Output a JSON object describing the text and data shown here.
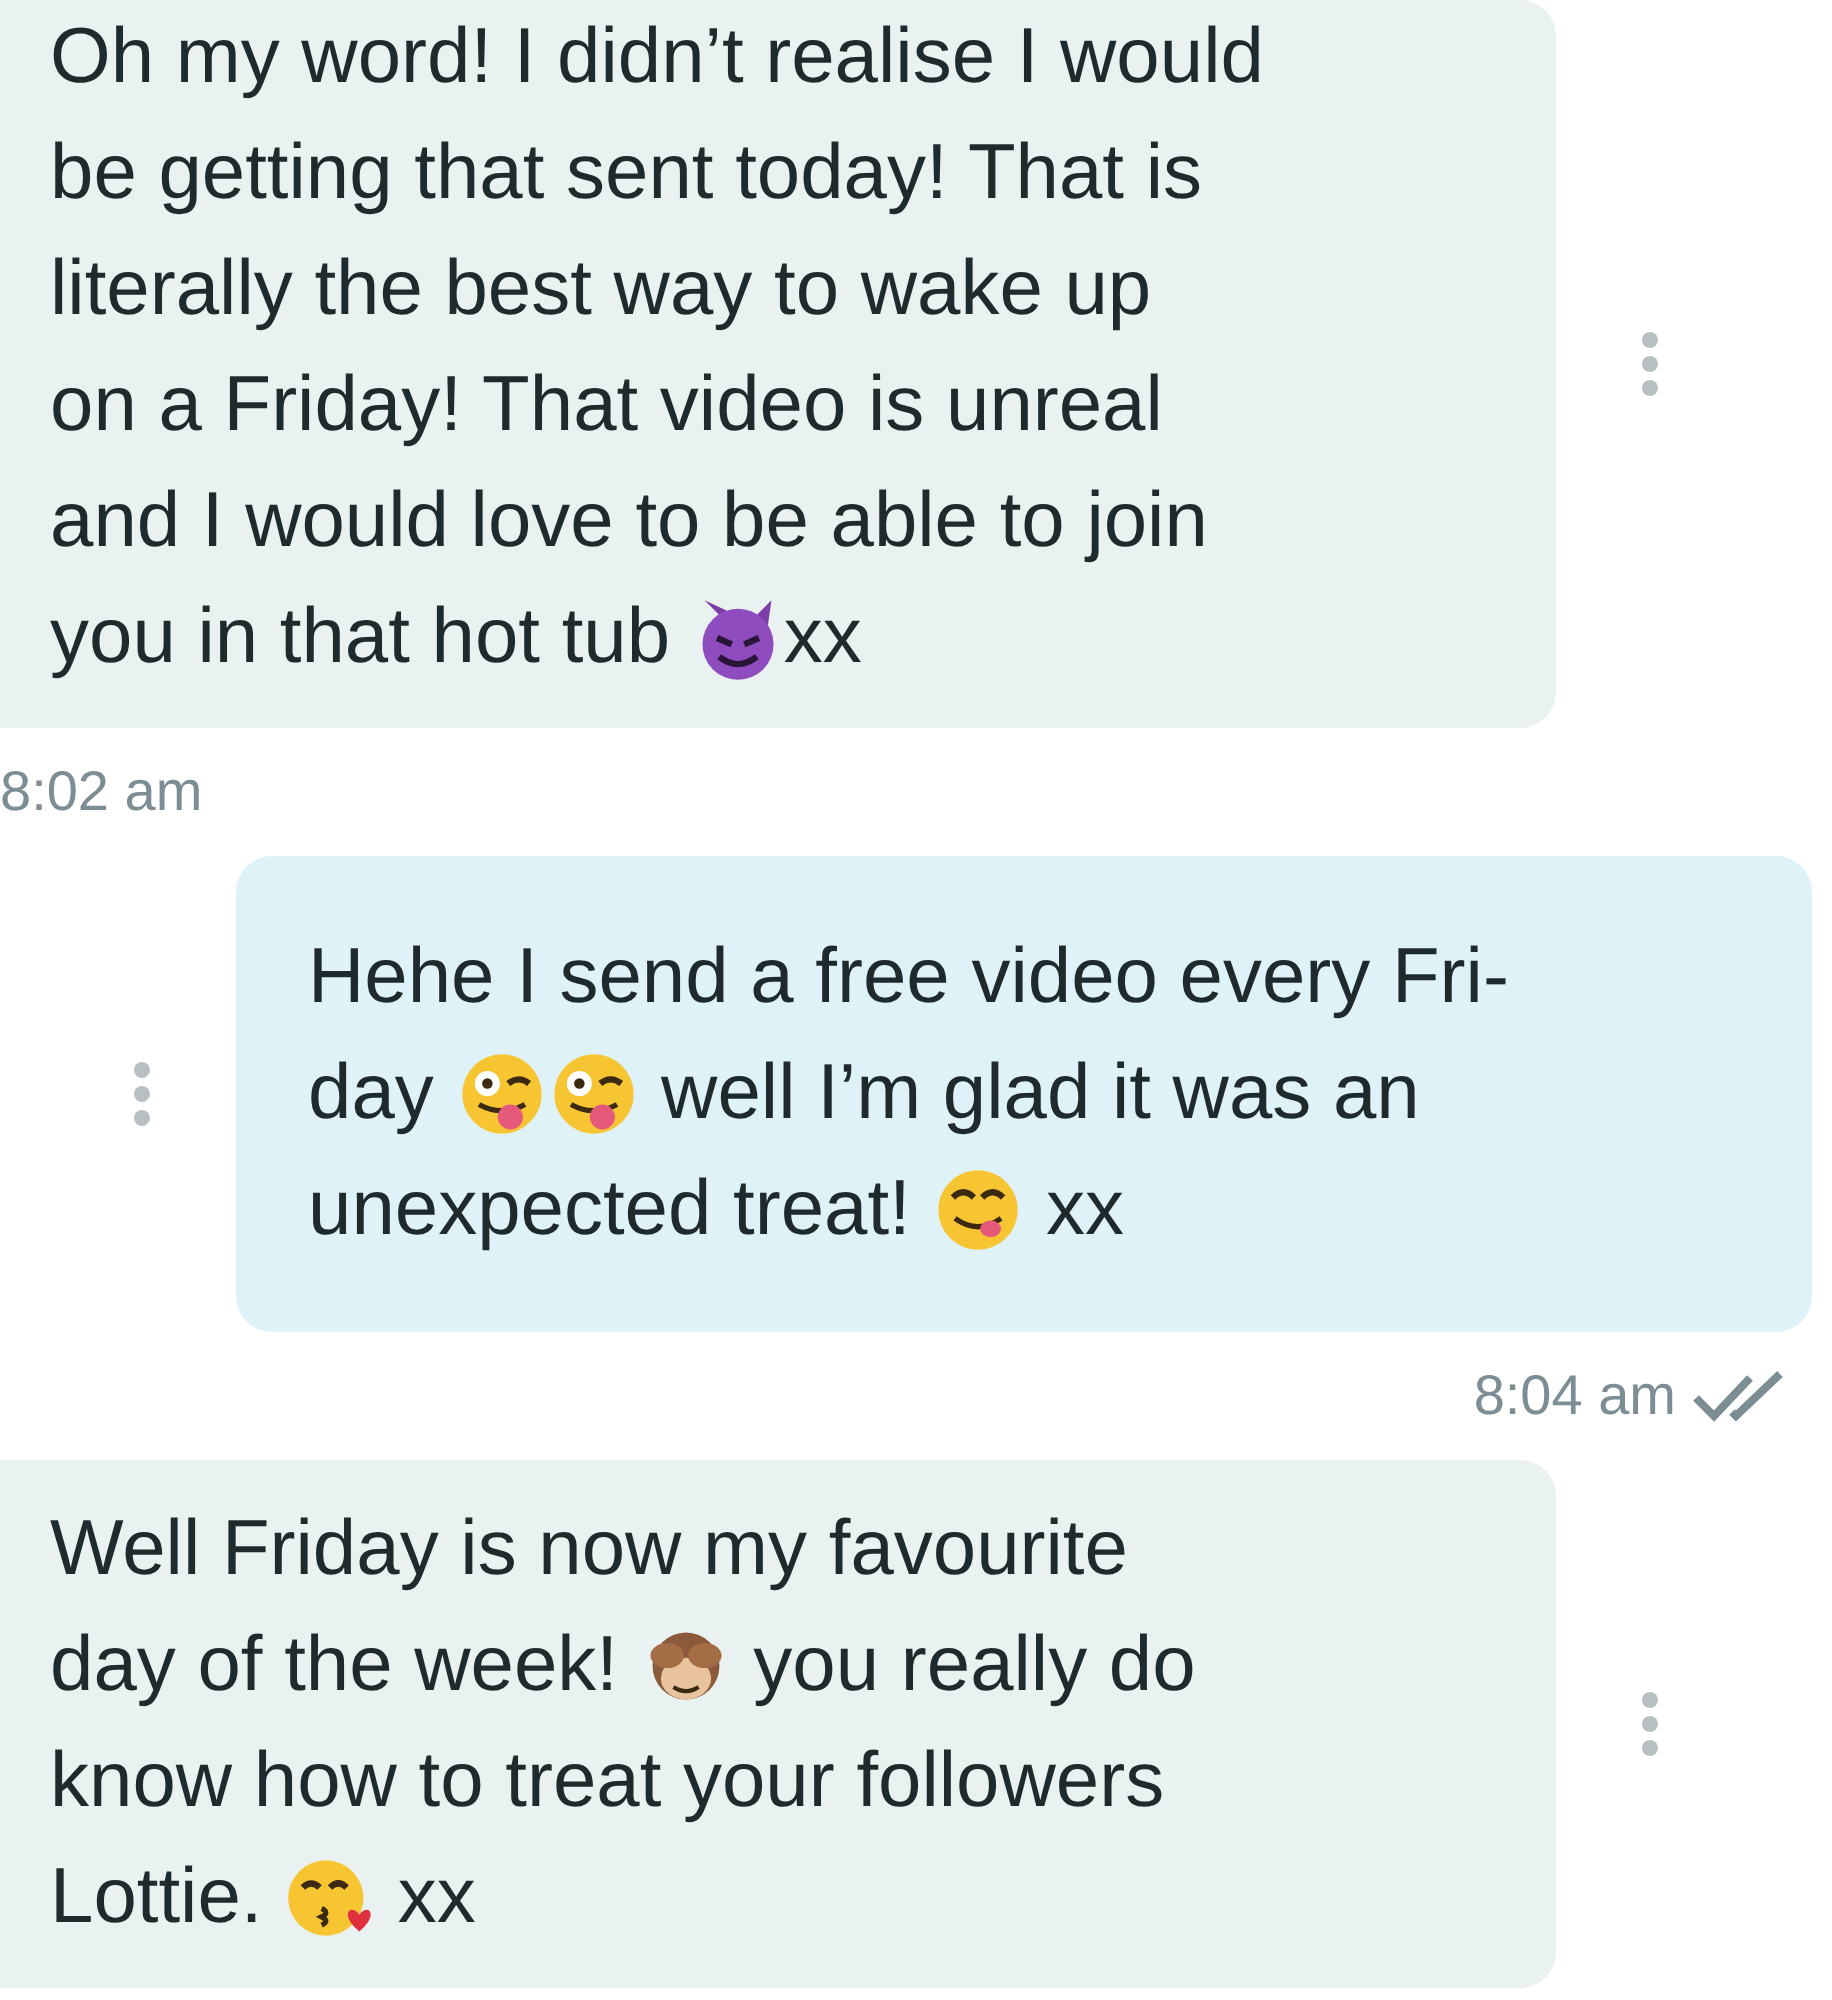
{
  "messages": [
    {
      "kind": "in",
      "lines": [
        [
          {
            "kind": "text",
            "text": "Oh my word! I didn’t realise I would"
          }
        ],
        [
          {
            "kind": "text",
            "text": "be getting that sent today! That is"
          }
        ],
        [
          {
            "kind": "text",
            "text": "literally the best way to wake up"
          }
        ],
        [
          {
            "kind": "text",
            "text": "on a Friday! That video is unreal"
          }
        ],
        [
          {
            "kind": "text",
            "text": "and I would love to be able to join"
          }
        ],
        [
          {
            "kind": "text",
            "text": "you in that hot tub "
          },
          {
            "kind": "devil"
          },
          {
            "kind": "text",
            "text": "xx"
          }
        ]
      ],
      "time": "8:02 am"
    },
    {
      "kind": "out",
      "lines": [
        [
          {
            "kind": "text",
            "text": "Hehe I send a free video every Fri-"
          }
        ],
        [
          {
            "kind": "text",
            "text": "day "
          },
          {
            "kind": "wink"
          },
          {
            "kind": "wink"
          },
          {
            "kind": "text",
            "text": " well I’m glad it was an"
          }
        ],
        [
          {
            "kind": "text",
            "text": "unexpected treat! "
          },
          {
            "kind": "yum"
          },
          {
            "kind": "text",
            "text": " xx"
          }
        ]
      ],
      "time": "8:04 am",
      "read": true
    },
    {
      "kind": "in",
      "lines": [
        [
          {
            "kind": "text",
            "text": "Well Friday is now my favourite"
          }
        ],
        [
          {
            "kind": "text",
            "text": "day of the week! "
          },
          {
            "kind": "monkey"
          },
          {
            "kind": "text",
            "text": " you really do"
          }
        ],
        [
          {
            "kind": "text",
            "text": "know how to treat your followers"
          }
        ],
        [
          {
            "kind": "text",
            "text": "Lottie. "
          },
          {
            "kind": "kiss"
          },
          {
            "kind": "text",
            "text": " xx"
          }
        ]
      ]
    }
  ]
}
